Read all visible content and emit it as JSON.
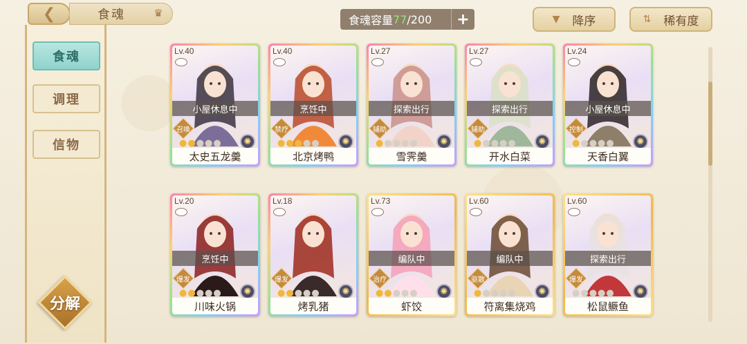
{
  "header": {
    "back_icon": "chevron-left-icon",
    "title": "食魂",
    "crown_icon": "crown-icon",
    "capacity_label": "食魂容量 ",
    "capacity_current": "77",
    "capacity_sep_max": "/200",
    "add_label": "+",
    "sort_desc_label": "降序",
    "sort_rarity_label": "稀有度"
  },
  "sidebar": {
    "tabs": [
      {
        "label": "食魂",
        "active": true
      },
      {
        "label": "调理",
        "active": false
      },
      {
        "label": "信物",
        "active": false
      }
    ],
    "decompose_label": "分解"
  },
  "cards": [
    {
      "level": "Lv.40",
      "status": "小屋休息中",
      "role": "召唤",
      "stars": 2,
      "name": "太史五龙羹",
      "frame": "rainbow"
    },
    {
      "level": "Lv.40",
      "status": "烹饪中",
      "role": "禁疗",
      "stars": 3,
      "name": "北京烤鸭",
      "frame": "rainbow"
    },
    {
      "level": "Lv.27",
      "status": "探索出行",
      "role": "辅助",
      "stars": 1,
      "name": "雪霁羹",
      "frame": "rainbow"
    },
    {
      "level": "Lv.27",
      "status": "探索出行",
      "role": "辅助",
      "stars": 1,
      "name": "开水白菜",
      "frame": "rainbow"
    },
    {
      "level": "Lv.24",
      "status": "小屋休息中",
      "role": "控制",
      "stars": 1,
      "name": "天香白翼",
      "frame": "rainbow"
    },
    {
      "level": "Lv.20",
      "status": "烹饪中",
      "role": "爆发",
      "stars": 2,
      "name": "川味火锅",
      "frame": "rainbow"
    },
    {
      "level": "Lv.18",
      "status": "",
      "role": "爆发",
      "stars": 2,
      "name": "烤乳猪",
      "frame": "rainbow"
    },
    {
      "level": "Lv.73",
      "status": "编队中",
      "role": "治疗",
      "stars": 2,
      "name": "虾饺",
      "frame": "gold"
    },
    {
      "level": "Lv.60",
      "status": "编队中",
      "role": "驱散",
      "stars": 1,
      "name": "符离集烧鸡",
      "frame": "gold"
    },
    {
      "level": "Lv.60",
      "status": "探索出行",
      "role": "爆发",
      "stars": 0,
      "name": "松鼠鳜鱼",
      "frame": "gold"
    }
  ]
}
